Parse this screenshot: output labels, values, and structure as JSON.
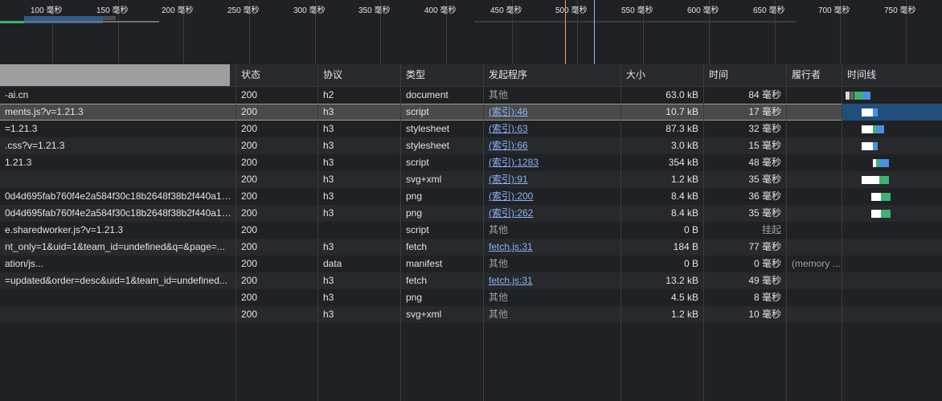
{
  "overview": {
    "ticks": [
      {
        "label": "100 毫秒"
      },
      {
        "label": "150 毫秒"
      },
      {
        "label": "200 毫秒"
      },
      {
        "label": "250 毫秒"
      },
      {
        "label": "300 毫秒"
      },
      {
        "label": "350 毫秒"
      },
      {
        "label": "400 毫秒"
      },
      {
        "label": "450 毫秒"
      },
      {
        "label": "500 毫秒"
      },
      {
        "label": "550 毫秒"
      },
      {
        "label": "600 毫秒"
      },
      {
        "label": "650 毫秒"
      },
      {
        "label": "700 毫秒"
      },
      {
        "label": "750 毫秒"
      }
    ],
    "dcl_color": "#e8a05a",
    "load_color": "#7ec7e0"
  },
  "columns": {
    "name": "",
    "status": "状态",
    "protocol": "协议",
    "type": "类型",
    "initiator": "发起程序",
    "size": "大小",
    "time": "时间",
    "fulfilled_by": "履行者",
    "waterfall": "时间线"
  },
  "colors": {
    "background": "#202124",
    "selected_row": "#4a4a4a",
    "link": "#8ab4f8",
    "waiting": "#3cb371",
    "download": "#4a90e2"
  },
  "rows": [
    {
      "name": "-ai.cn",
      "status": "200",
      "protocol": "h2",
      "type": "document",
      "initiator": "其他",
      "initiator_link": false,
      "size": "63.0 kB",
      "time": "84 毫秒",
      "fulfilled_by": ""
    },
    {
      "name": "ments.js?v=1.21.3",
      "status": "200",
      "protocol": "h3",
      "type": "script",
      "initiator": "(索引):46",
      "initiator_link": true,
      "size": "10.7 kB",
      "time": "17 毫秒",
      "fulfilled_by": "",
      "selected": true
    },
    {
      "name": "=1.21.3",
      "status": "200",
      "protocol": "h3",
      "type": "stylesheet",
      "initiator": "(索引):63",
      "initiator_link": true,
      "size": "87.3 kB",
      "time": "32 毫秒",
      "fulfilled_by": ""
    },
    {
      "name": ".css?v=1.21.3",
      "status": "200",
      "protocol": "h3",
      "type": "stylesheet",
      "initiator": "(索引):66",
      "initiator_link": true,
      "size": "3.0 kB",
      "time": "15 毫秒",
      "fulfilled_by": ""
    },
    {
      "name": "1.21.3",
      "status": "200",
      "protocol": "h3",
      "type": "script",
      "initiator": "(索引):1283",
      "initiator_link": true,
      "size": "354 kB",
      "time": "48 毫秒",
      "fulfilled_by": ""
    },
    {
      "name": "",
      "status": "200",
      "protocol": "h3",
      "type": "svg+xml",
      "initiator": "(索引):91",
      "initiator_link": true,
      "size": "1.2 kB",
      "time": "35 毫秒",
      "fulfilled_by": ""
    },
    {
      "name": "0d4d695fab760f4e2a584f30c18b2648f38b2f440a12b...",
      "status": "200",
      "protocol": "h3",
      "type": "png",
      "initiator": "(索引):200",
      "initiator_link": true,
      "size": "8.4 kB",
      "time": "36 毫秒",
      "fulfilled_by": ""
    },
    {
      "name": "0d4d695fab760f4e2a584f30c18b2648f38b2f440a12b...",
      "status": "200",
      "protocol": "h3",
      "type": "png",
      "initiator": "(索引):262",
      "initiator_link": true,
      "size": "8.4 kB",
      "time": "35 毫秒",
      "fulfilled_by": ""
    },
    {
      "name": "e.sharedworker.js?v=1.21.3",
      "status": "200",
      "protocol": "",
      "type": "script",
      "initiator": "其他",
      "initiator_link": false,
      "size": "0 B",
      "time": "挂起",
      "fulfilled_by": ""
    },
    {
      "name": "nt_only=1&uid=1&team_id=undefined&q=&page=...",
      "status": "200",
      "protocol": "h3",
      "type": "fetch",
      "initiator": "fetch.js:31",
      "initiator_link": true,
      "size": "184 B",
      "time": "77 毫秒",
      "fulfilled_by": ""
    },
    {
      "name": "ation/js...",
      "status": "200",
      "protocol": "data",
      "type": "manifest",
      "initiator": "其他",
      "initiator_link": false,
      "size": "0 B",
      "time": "0 毫秒",
      "fulfilled_by": "(memory ..."
    },
    {
      "name": "=updated&order=desc&uid=1&team_id=undefined...",
      "status": "200",
      "protocol": "h3",
      "type": "fetch",
      "initiator": "fetch.js:31",
      "initiator_link": true,
      "size": "13.2 kB",
      "time": "49 毫秒",
      "fulfilled_by": ""
    },
    {
      "name": "",
      "status": "200",
      "protocol": "h3",
      "type": "png",
      "initiator": "其他",
      "initiator_link": false,
      "size": "4.5 kB",
      "time": "8 毫秒",
      "fulfilled_by": ""
    },
    {
      "name": "",
      "status": "200",
      "protocol": "h3",
      "type": "svg+xml",
      "initiator": "其他",
      "initiator_link": false,
      "size": "1.2 kB",
      "time": "10 毫秒",
      "fulfilled_by": ""
    }
  ]
}
